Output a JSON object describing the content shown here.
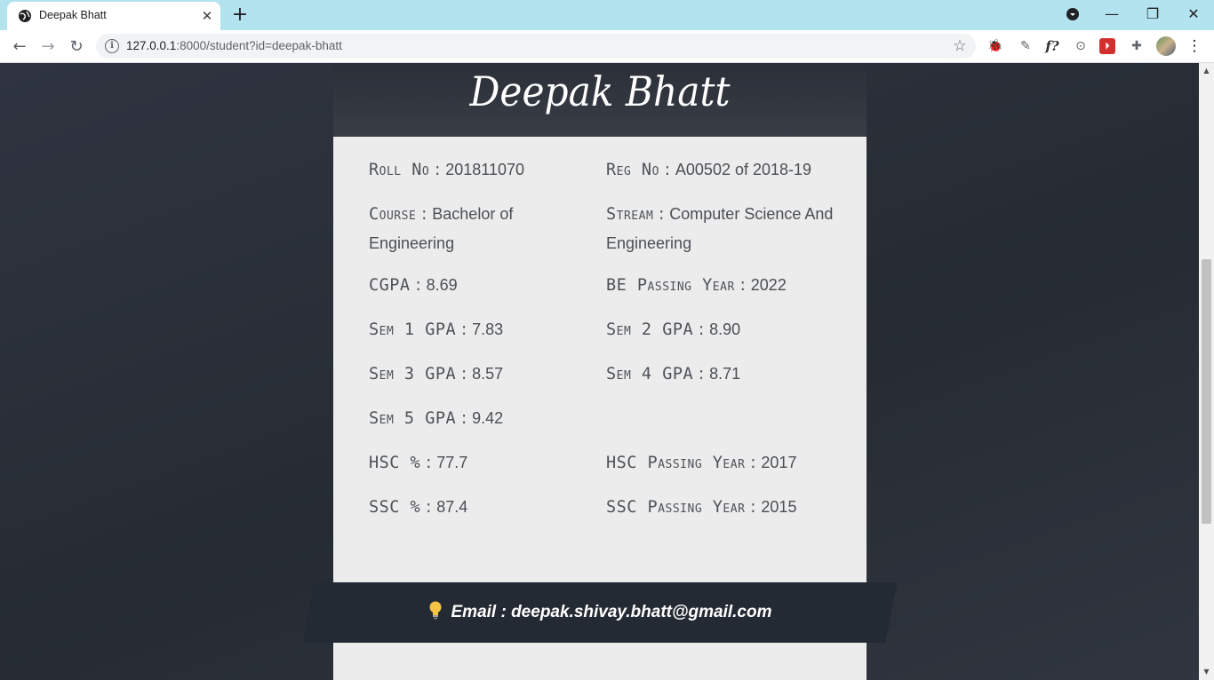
{
  "browser": {
    "tab_title": "Deepak Bhatt",
    "url_host": "127.0.0.1",
    "url_rest": ":8000/student?id=deepak-bhatt"
  },
  "student": {
    "name": "Deepak Bhatt",
    "fields": {
      "roll_no": {
        "label": "Roll No",
        "value": "201811070"
      },
      "reg_no": {
        "label": "Reg No",
        "value": "A00502 of 2018-19"
      },
      "course": {
        "label": "Course",
        "value": "Bachelor of Engineering"
      },
      "stream": {
        "label": "Stream",
        "value": "Computer Science And Engineering"
      },
      "cgpa": {
        "label": "CGPA",
        "value": "8.69"
      },
      "be_passing_year": {
        "label": "BE Passing Year",
        "value": "2022"
      },
      "sem1": {
        "label": "Sem 1 GPA",
        "value": "7.83"
      },
      "sem2": {
        "label": "Sem 2 GPA",
        "value": "8.90"
      },
      "sem3": {
        "label": "Sem 3 GPA",
        "value": "8.57"
      },
      "sem4": {
        "label": "Sem 4 GPA",
        "value": "8.71"
      },
      "sem5": {
        "label": "Sem 5 GPA",
        "value": "9.42"
      },
      "hsc_pct": {
        "label": "HSC %",
        "value": "77.7"
      },
      "hsc_year": {
        "label": "HSC Passing Year",
        "value": "2017"
      },
      "ssc_pct": {
        "label": "SSC %",
        "value": "87.4"
      },
      "ssc_year": {
        "label": "SSC Passing Year",
        "value": "2015"
      }
    },
    "separator": " : ",
    "email_text": "Email : deepak.shivay.bhatt@gmail.com"
  }
}
